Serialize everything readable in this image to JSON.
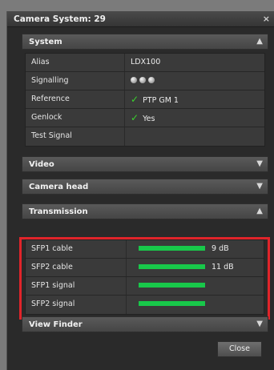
{
  "dialog": {
    "title": "Camera System: 29",
    "close_icon": "×"
  },
  "sections": {
    "system": {
      "label": "System",
      "arrow": "▲"
    },
    "video": {
      "label": "Video",
      "arrow": "▼"
    },
    "camera_head": {
      "label": "Camera head",
      "arrow": "▼"
    },
    "transmission": {
      "label": "Transmission",
      "arrow": "▲"
    },
    "view_finder": {
      "label": "View Finder",
      "arrow": "▼"
    }
  },
  "system_rows": {
    "alias": {
      "key": "Alias",
      "value": "LDX100"
    },
    "signalling": {
      "key": "Signalling",
      "indicator_icons": [
        "dot-icon",
        "dot-icon",
        "dot-icon"
      ]
    },
    "reference": {
      "key": "Reference",
      "value": "PTP GM 1",
      "status_icon": "check-icon"
    },
    "genlock": {
      "key": "Genlock",
      "value": "Yes",
      "status_icon": "check-icon"
    },
    "test_signal": {
      "key": "Test Signal",
      "value": ""
    }
  },
  "transmission_rows": [
    {
      "key": "SFP1 cable",
      "level": 1.0,
      "value": "9 dB"
    },
    {
      "key": "SFP2 cable",
      "level": 1.0,
      "value": "11 dB"
    },
    {
      "key": "SFP1 signal",
      "level": 1.0,
      "value": ""
    },
    {
      "key": "SFP2 signal",
      "level": 1.0,
      "value": ""
    }
  ],
  "colors": {
    "bar_fill": "#18c84a",
    "highlight_border": "#e0242a",
    "check": "#3bd12f"
  },
  "buttons": {
    "close_label": "Close"
  }
}
